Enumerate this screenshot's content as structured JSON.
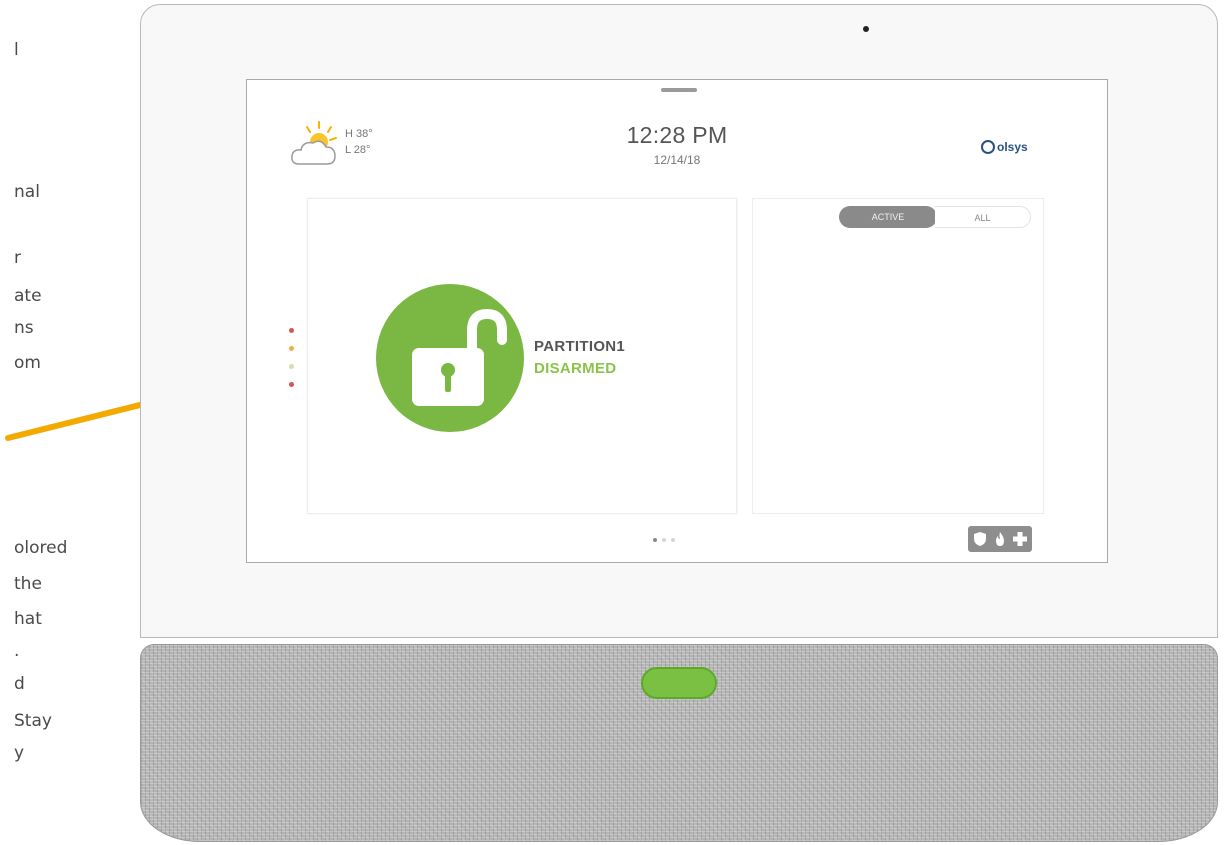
{
  "side_text": {
    "upper": [
      "l",
      "nal",
      "r",
      "ate",
      "ns",
      "om"
    ],
    "lower": [
      "olored",
      "the",
      "hat",
      ".",
      "d",
      "Stay",
      "y"
    ]
  },
  "screen": {
    "weather": {
      "high": "H 38°",
      "low": "L 28°",
      "icon": "partly-cloudy-icon"
    },
    "clock": {
      "time": "12:28 PM",
      "date": "12/14/18"
    },
    "brand": {
      "logo_text": "olsys"
    },
    "partition": {
      "name": "PARTITION1",
      "status": "DISARMED",
      "icon": "unlocked-padlock-icon"
    },
    "partition_indicators": [
      {
        "color": "#d9534f"
      },
      {
        "color": "#f0ad4e"
      },
      {
        "color": "#cfe3a8"
      },
      {
        "color": "#d9534f"
      }
    ],
    "tabs": {
      "active_label": "ACTIVE",
      "all_label": "ALL"
    },
    "page_indicator": {
      "count": 3,
      "current": 1
    },
    "emergency_icons": [
      "shield-icon",
      "flame-icon",
      "medical-cross-icon"
    ]
  },
  "colors": {
    "disarmed_green": "#7ab843",
    "status_text_green": "#8bc34a",
    "arrow_orange": "#f2a900",
    "brand_blue": "#2a5280"
  }
}
